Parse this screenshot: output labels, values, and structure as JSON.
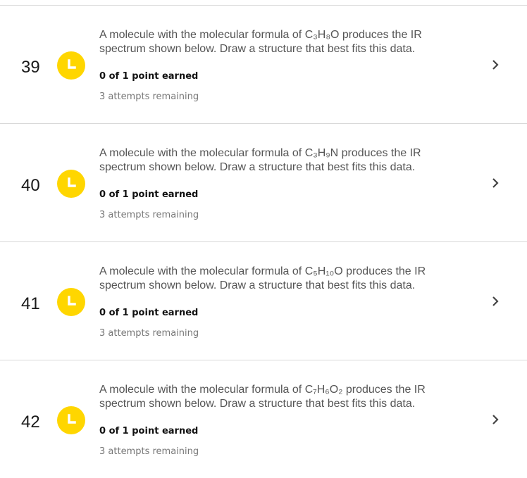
{
  "colors": {
    "status_pending": "#ffd600",
    "divider": "#d9d9d9"
  },
  "items": [
    {
      "number": "39",
      "status_icon": "clock-icon",
      "question": "A molecule with the molecular formula of C₃H₈O produces the IR spectrum shown below. Draw a structure that best fits this data.",
      "score": "0 of 1 point earned",
      "attempts": "3 attempts remaining"
    },
    {
      "number": "40",
      "status_icon": "clock-icon",
      "question": "A molecule with the molecular formula of C₃H₉N produces the IR spectrum shown below. Draw a structure that best fits this data.",
      "score": "0 of 1 point earned",
      "attempts": "3 attempts remaining"
    },
    {
      "number": "41",
      "status_icon": "clock-icon",
      "question": "A molecule with the molecular formula of C₅H₁₀O produces the IR spectrum shown below. Draw a structure that best fits this data.",
      "score": "0 of 1 point earned",
      "attempts": "3 attempts remaining"
    },
    {
      "number": "42",
      "status_icon": "clock-icon",
      "question": "A molecule with the molecular formula of C₇H₆O₂ produces the IR spectrum shown below. Draw a structure that best fits this data.",
      "score": "0 of 1 point earned",
      "attempts": "3 attempts remaining"
    }
  ]
}
